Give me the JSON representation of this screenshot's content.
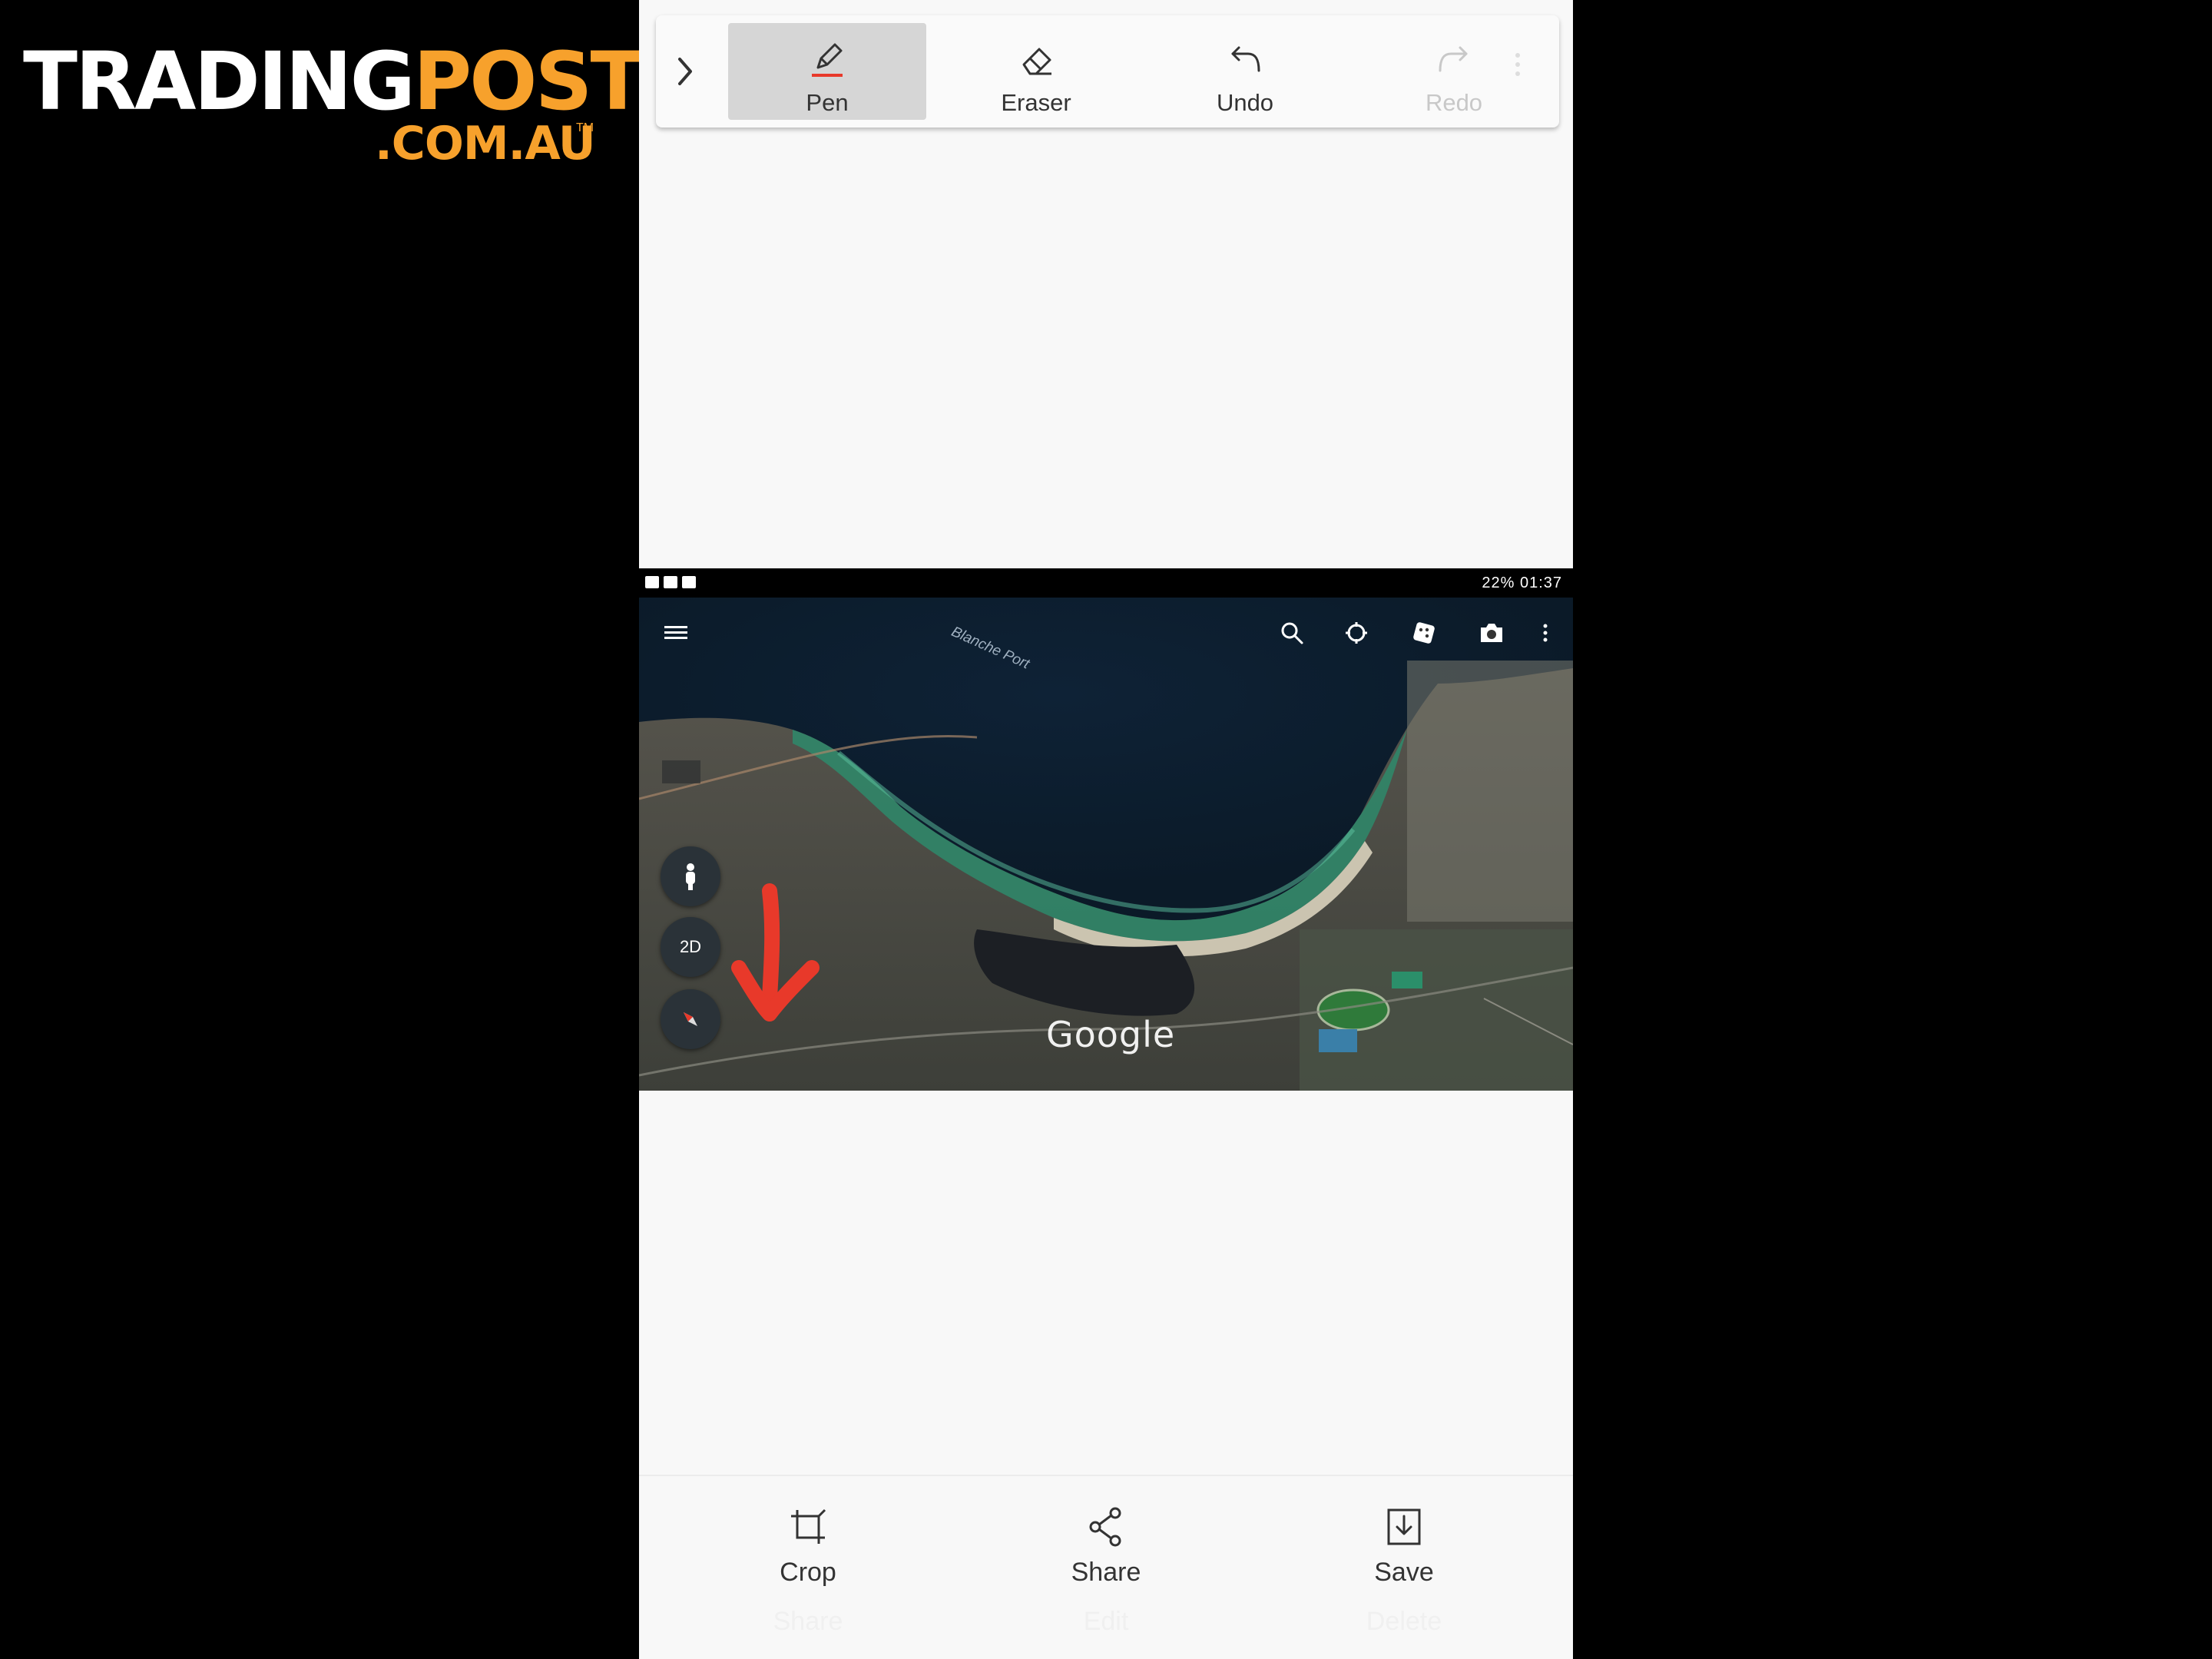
{
  "logo": {
    "part1": "TRADING",
    "part2": "POST",
    "domain": ".COM.AU",
    "tm": "TM"
  },
  "toolbar": {
    "items": [
      {
        "label": "Pen",
        "icon": "pen-icon",
        "active": true
      },
      {
        "label": "Eraser",
        "icon": "eraser-icon"
      },
      {
        "label": "Undo",
        "icon": "undo-icon"
      },
      {
        "label": "Redo",
        "icon": "redo-icon",
        "disabled": true
      }
    ],
    "expand_icon": "chevron-right-icon",
    "more_icon": "more-vert-icon"
  },
  "screenshot": {
    "status_right": "22% 01:37",
    "place_label": "Blanche Port",
    "watermark": "Google",
    "buttons": [
      {
        "label": "",
        "icon": "person-icon"
      },
      {
        "label": "2D",
        "icon": ""
      },
      {
        "label": "",
        "icon": "compass-icon"
      }
    ],
    "top_icons": [
      "menu-icon",
      "search-icon",
      "voyager-icon",
      "feeling-lucky-icon",
      "camera-icon",
      "more-vert-icon"
    ]
  },
  "bottombar": {
    "items": [
      {
        "label": "Crop",
        "icon": "crop-icon",
        "ghost": "Share"
      },
      {
        "label": "Share",
        "icon": "share-icon",
        "ghost": "Edit"
      },
      {
        "label": "Save",
        "icon": "save-icon",
        "ghost": "Delete"
      }
    ]
  },
  "colors": {
    "brand_orange": "#f7a12c",
    "annotation_red": "#e8392a",
    "background": "#000000"
  }
}
